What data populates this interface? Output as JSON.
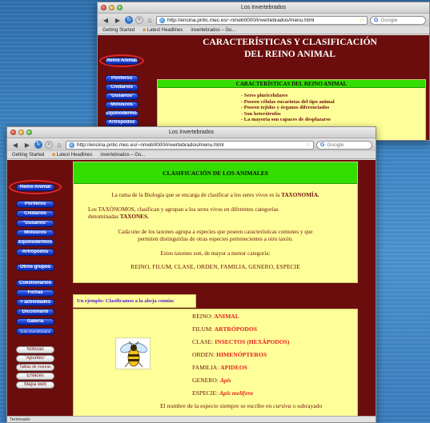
{
  "back_window": {
    "title": "Los Invertebrados",
    "url": "http://encina.pntic.mec.es/~nmeb0000/invertebrados/menu.html",
    "search_placeholder": "Google",
    "bookmarks": [
      "Getting Started",
      "Latest Headlines",
      "invertebrados – Go..."
    ],
    "heading_line1": "CARACTERÍSTICAS Y CLASIFICACIÓN",
    "heading_line2": "DEL REINO ANIMAL",
    "nav": [
      "Reino Animal",
      "Poríferos",
      "Cnidarios",
      "\"Gusanos\"",
      "Moluscos",
      "Equinodermos",
      "Artrópodos"
    ],
    "panel_title": "CARACTERÍSTICAS DEL REINO ANIMAL",
    "bullets": [
      "- Seres pluricelulares",
      "- Poseen células eucariotas del tipo animal",
      "- Poseen tejidos y órganos diferenciados",
      "- Son heterótrofos",
      "- La mayoría son capaces de desplazarse"
    ]
  },
  "front_window": {
    "title": "Los Invertebrados",
    "url": "http://encina.pntic.mec.es/~nmeb0000/invertebrados/menu.html",
    "search_placeholder": "Google",
    "bookmarks": [
      "Getting Started",
      "Latest Headlines",
      "invertebrados – Go..."
    ],
    "nav_primary": [
      "Reino Animal",
      "Poríferos",
      "Cnidarios",
      "\"Gusanos\"",
      "Moluscos",
      "Equinodermos",
      "Artrópodos"
    ],
    "nav_groups": "Otros grupos",
    "nav_tools": [
      "Cuestionarios",
      "Fichas",
      "+ actividades",
      "Diccionario",
      "Galería",
      "Guía invertebrados"
    ],
    "nav_links": [
      "Noticias",
      "\"Apuntes\"",
      "Tablas de mareas",
      "Enlaces",
      "Mapa web"
    ],
    "panel_title": "CLASIFICACIÓN DE LOS ANIMALES",
    "p1_a": "La rama de la Biología que se encarga de clasificar a los seres vivos es la",
    "p1_b": "TAXONOMÍA.",
    "p2_a": "Los TAXÓNOMOS, clasifican y agrupan a los seres vivos en diferentes categorías",
    "p2_b": "denominadas",
    "p2_c": "TAXONES.",
    "p3_a": "Cada uno de los taxones agrupa a especies que poseen características comunes y que",
    "p3_b": "permiten distinguirlas de otras especies pertenecientes a otro taxón.",
    "p4": "Estos taxones son, de mayor a menor categoría:",
    "p5": "REINO, FILUM, CLASE, ORDEN, FAMILIA, GENERO, ESPECIE",
    "example_label": "Un ejemplo: Clasificamos a la abeja común:",
    "taxonomy": [
      {
        "rank": "REINO:",
        "value": "ANIMAL"
      },
      {
        "rank": "FILUM:",
        "value": "ARTRÓPODOS"
      },
      {
        "rank": "CLASE:",
        "value": "INSECTOS (HEXÁPODOS)"
      },
      {
        "rank": "ORDEN:",
        "value": "HIMENÓPTEROS"
      },
      {
        "rank": "FAMILIA:",
        "value": "APIDEOS"
      },
      {
        "rank": "GENERO:",
        "value": "Apis"
      },
      {
        "rank": "ESPECIE:",
        "value": "Apis melífera"
      }
    ],
    "footnote_a": "El nombre de la especie siempre se escribe en",
    "footnote_b": "cursiva",
    "footnote_c": "o subrayado",
    "status": "Terminado"
  },
  "colors": {
    "page_bg": "#6b0d0d",
    "panel": "#ffff99",
    "panel_head": "#33dd00",
    "accent_red": "#e62020",
    "nav_blue": "#1f3fd0",
    "highlight_circle": "#e12828"
  },
  "icons": [
    "back-arrow-icon",
    "forward-arrow-icon",
    "reload-icon",
    "stop-icon",
    "home-icon",
    "globe-icon",
    "bookmark-star-icon",
    "google-icon",
    "rss-feed-icon",
    "bee-image"
  ]
}
